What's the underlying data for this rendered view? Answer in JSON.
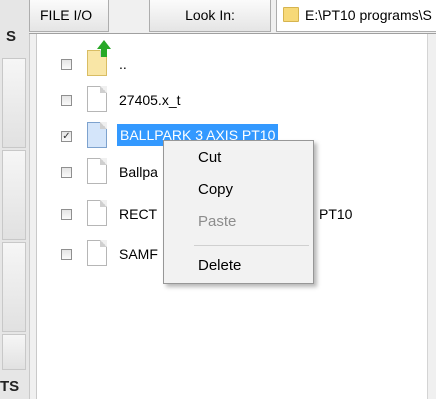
{
  "toolbar": {
    "file_io_label": "FILE I/O",
    "look_in_label": "Look In:",
    "path": "E:\\PT10 programs\\S"
  },
  "leftbar": {
    "top_fragment": "S",
    "bottom_fragment": "TS"
  },
  "files": [
    {
      "name": "..",
      "checked": false,
      "type": "parent-folder"
    },
    {
      "name": "27405.x_t",
      "checked": false,
      "type": "file"
    },
    {
      "name": "BALLPARK 3 AXIS PT10",
      "checked": true,
      "type": "file",
      "selected": true
    },
    {
      "name": "Ballpa",
      "checked": false,
      "type": "file"
    },
    {
      "name": "RECT",
      "suffix": "PT10",
      "checked": false,
      "type": "file"
    },
    {
      "name": "SAMF",
      "checked": false,
      "type": "file"
    }
  ],
  "context_menu": {
    "items": [
      {
        "label": "Cut",
        "enabled": true
      },
      {
        "label": "Copy",
        "enabled": true
      },
      {
        "label": "Paste",
        "enabled": false
      },
      {
        "label": "Delete",
        "enabled": true
      }
    ]
  },
  "colors": {
    "selection": "#3399ff",
    "menu_bg": "#f2f2f2",
    "disabled_text": "#8d8d8d"
  }
}
